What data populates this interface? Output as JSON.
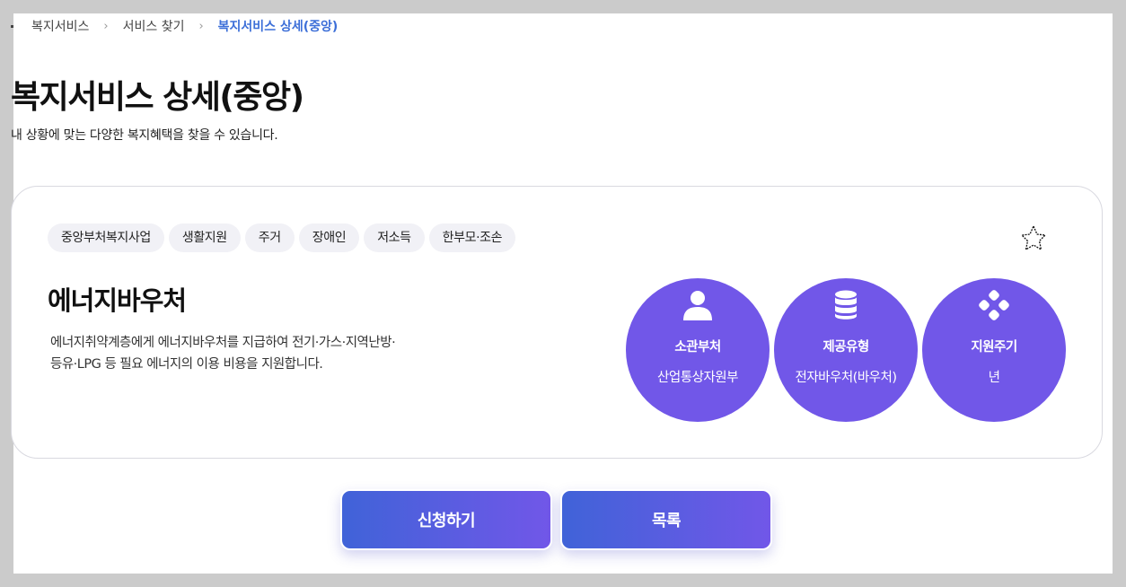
{
  "breadcrumb": {
    "items": [
      "복지서비스",
      "서비스 찾기"
    ],
    "current": "복지서비스 상세(중앙)"
  },
  "header": {
    "title": "복지서비스 상세(중앙)",
    "subtitle": "내 상황에 맞는 다양한 복지혜택을 찾을 수 있습니다."
  },
  "card": {
    "tags": [
      "중앙부처복지사업",
      "생활지원",
      "주거",
      "장애인",
      "저소득",
      "한부모·조손"
    ],
    "title": "에너지바우처",
    "description": "에너지취약계층에게 에너지바우처를 지급하여 전기·가스·지역난방·등유·LPG 등 필요 에너지의 이용 비용을 지원합니다.",
    "info": [
      {
        "icon": "person-icon",
        "label": "소관부처",
        "value": "산업통상자원부"
      },
      {
        "icon": "database-icon",
        "label": "제공유형",
        "value": "전자바우처(바우처)"
      },
      {
        "icon": "cycle-icon",
        "label": "지원주기",
        "value": "년"
      }
    ]
  },
  "buttons": {
    "apply": "신청하기",
    "list": "목록"
  },
  "colors": {
    "accent": "#7157e8",
    "button_start": "#4063d8",
    "breadcrumb_current": "#3d6fd8"
  }
}
